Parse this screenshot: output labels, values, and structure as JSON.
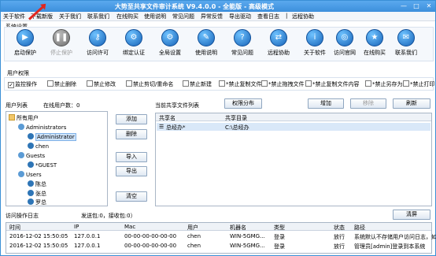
{
  "window": {
    "title": "大势至共享文件审计系统 V9.4.0.0 - 全能版 - 高级模式"
  },
  "menu": [
    "关于软件",
    "下载新版",
    "关于我们",
    "联系我们",
    "在线购买",
    "使用说明",
    "常见问题",
    "异常反馈",
    "导出驱动",
    "查看日志",
    "|",
    "远程协助"
  ],
  "system_settings_label": "系统设置",
  "toolbar": [
    {
      "label": "启动保护",
      "icon": "play-icon",
      "disabled": false
    },
    {
      "label": "停止保护",
      "icon": "pause-icon",
      "disabled": true
    },
    {
      "label": "访问许可",
      "icon": "key-icon",
      "disabled": false
    },
    {
      "label": "绑定认证",
      "icon": "bind-icon",
      "disabled": false
    },
    {
      "label": "全局设置",
      "icon": "settings-icon",
      "disabled": false
    },
    {
      "label": "使用说明",
      "icon": "book-icon",
      "disabled": false
    },
    {
      "label": "常见问题",
      "icon": "question-icon",
      "disabled": false
    },
    {
      "label": "远程协助",
      "icon": "remote-icon",
      "disabled": false
    },
    {
      "label": "关于软件",
      "icon": "about-icon",
      "disabled": false
    },
    {
      "label": "访问官网",
      "icon": "globe-icon",
      "disabled": false
    },
    {
      "label": "在线购买",
      "icon": "cart-icon",
      "disabled": false
    },
    {
      "label": "联系我们",
      "icon": "contact-icon",
      "disabled": false
    }
  ],
  "permissions_label": "用户权限",
  "permissions": [
    {
      "label": "监控操作",
      "checked": true
    },
    {
      "label": "禁止删除",
      "checked": false
    },
    {
      "label": "禁止修改",
      "checked": false
    },
    {
      "label": "禁止剪切/重命名",
      "checked": false
    },
    {
      "label": "禁止新建",
      "checked": false
    },
    {
      "label": "*禁止复制文件",
      "checked": false
    },
    {
      "label": "*禁止拖拽文件",
      "checked": false
    },
    {
      "label": "*禁止复制文件内容",
      "checked": false
    },
    {
      "label": "*禁止另存为",
      "checked": false
    },
    {
      "label": "*禁止打印",
      "checked": false
    }
  ],
  "user_list": {
    "label": "用户列表",
    "online_count": "在线用户数：0",
    "tree": [
      {
        "label": "所有用户",
        "level": 0,
        "selected": false
      },
      {
        "label": "Administrators",
        "level": 1,
        "selected": false
      },
      {
        "label": "Administrator",
        "level": 2,
        "selected": true
      },
      {
        "label": "chen",
        "level": 2,
        "selected": false
      },
      {
        "label": "Guests",
        "level": 1,
        "selected": false
      },
      {
        "label": "*GUEST",
        "level": 2,
        "selected": false
      },
      {
        "label": "Users",
        "level": 1,
        "selected": false
      },
      {
        "label": "陈总",
        "level": 2,
        "selected": false
      },
      {
        "label": "张总",
        "level": 2,
        "selected": false
      },
      {
        "label": "罗总",
        "level": 2,
        "selected": false
      }
    ],
    "buttons": [
      "添加",
      "删除",
      "导入",
      "导出",
      "清空"
    ]
  },
  "shared_files": {
    "label": "当前共享文件列表",
    "distribute_button": "权限分布",
    "add_button": "增加",
    "remove_button": "移除",
    "refresh_button": "刷新",
    "columns": [
      "共享名",
      "共享目录"
    ],
    "rows": [
      [
        "总经办*",
        "C:\\总经办"
      ]
    ]
  },
  "access_log": {
    "label": "访问操作日志",
    "stats": "发送包:0，接收包:0）",
    "clear_button": "清屏",
    "columns": [
      "时间",
      "IP",
      "Mac",
      "用户",
      "机器名",
      "类型",
      "状态",
      "路径"
    ],
    "rows": [
      [
        "2016-12-02 15:50:05",
        "127.0.0.1",
        "00-00-00-00-00-00",
        "chen",
        "WIN-5GMG...",
        "登录",
        "放行",
        "系统默认不存储用户访问日志，如"
      ],
      [
        "2016-12-02 15:50:05",
        "127.0.0.1",
        "00-00-00-00-00-00",
        "chen",
        "WIN-5GMG...",
        "登录",
        "放行",
        "管理员[admin]登录到本系统"
      ]
    ]
  }
}
